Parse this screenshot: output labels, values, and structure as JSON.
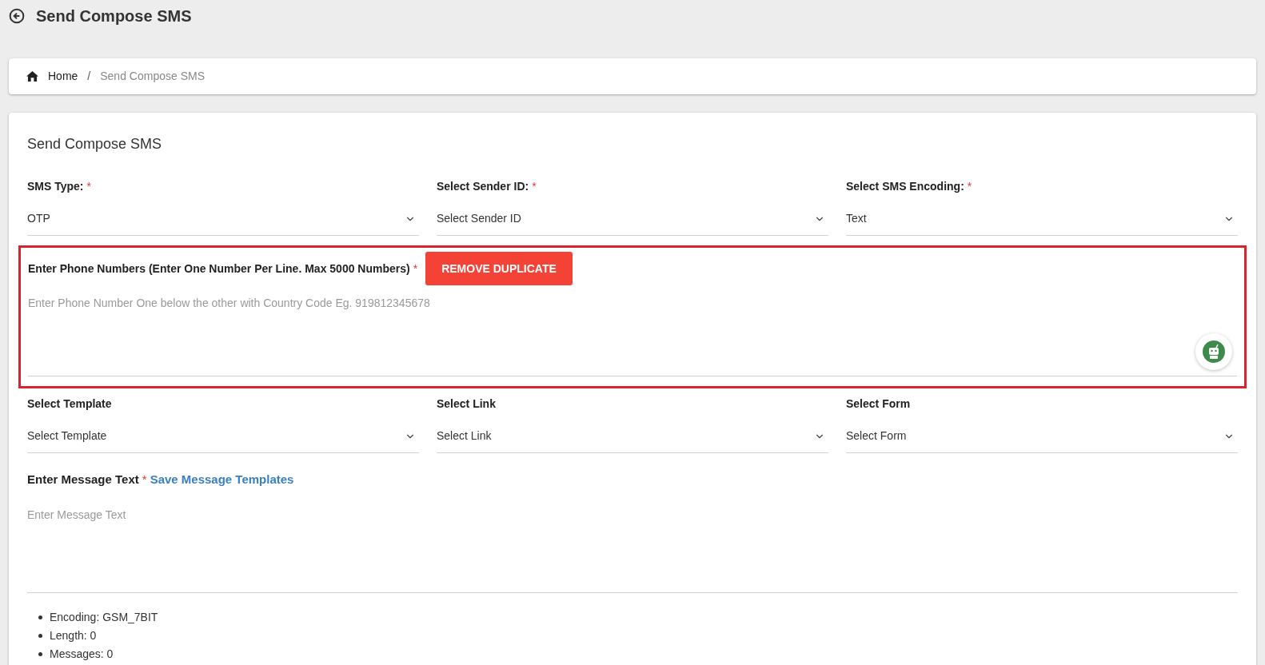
{
  "header": {
    "title": "Send Compose SMS"
  },
  "breadcrumb": [
    {
      "label": "Home",
      "current": false
    },
    {
      "label": "Send Compose SMS",
      "current": true
    }
  ],
  "breadcrumb_separator": "/",
  "card": {
    "title": "Send Compose SMS"
  },
  "row_1": [
    {
      "label": "SMS Type:",
      "required_mark": "*",
      "value": "OTP"
    },
    {
      "label": "Select Sender ID:",
      "required_mark": "*",
      "value": "Select Sender ID"
    },
    {
      "label": "Select SMS Encoding:",
      "required_mark": "*",
      "value": "Text"
    }
  ],
  "phone_numbers": {
    "label": "Enter Phone Numbers (Enter One Number Per Line. Max 5000 Numbers)",
    "required_mark": "*",
    "highlighted": true,
    "button": "REMOVE DUPLICATE",
    "placeholder": "Enter Phone Number One below the other with Country Code Eg. 919812345678"
  },
  "row_2": [
    {
      "label": "Select Template",
      "value": "Select Template"
    },
    {
      "label": "Select Link",
      "value": "Select Link"
    },
    {
      "label": "Select Form",
      "value": "Select Form"
    }
  ],
  "message": {
    "label": "Enter Message Text",
    "required_mark": "*",
    "link": "Save Message Templates",
    "placeholder": "Enter Message Text"
  },
  "stats": [
    "Encoding: GSM_7BIT",
    "Length: 0",
    "Messages: 0"
  ]
}
